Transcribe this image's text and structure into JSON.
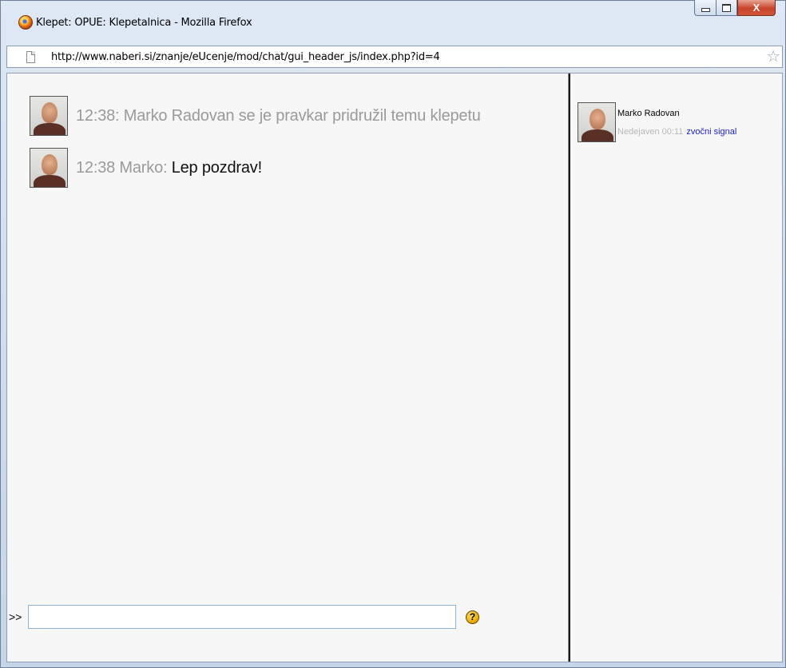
{
  "window": {
    "title": "Klepet: OPUE: Klepetalnica - Mozilla Firefox",
    "close_glyph": "X",
    "url": "http://www.naberi.si/znanje/eUcenje/mod/chat/gui_header_js/index.php?id=4",
    "star_glyph": "☆"
  },
  "chat": {
    "messages": [
      {
        "time": "12:38:",
        "text": " Marko Radovan se je pravkar pridružil temu klepetu",
        "body": ""
      },
      {
        "time": "12:38",
        "text": " Marko: ",
        "body": "Lep pozdrav!"
      }
    ],
    "input": {
      "prompt": ">>",
      "value": "",
      "help_glyph": "?"
    }
  },
  "users": [
    {
      "name": "Marko Radovan",
      "status": "Nedejaven 00:11",
      "action": "zvočni signal"
    }
  ]
}
